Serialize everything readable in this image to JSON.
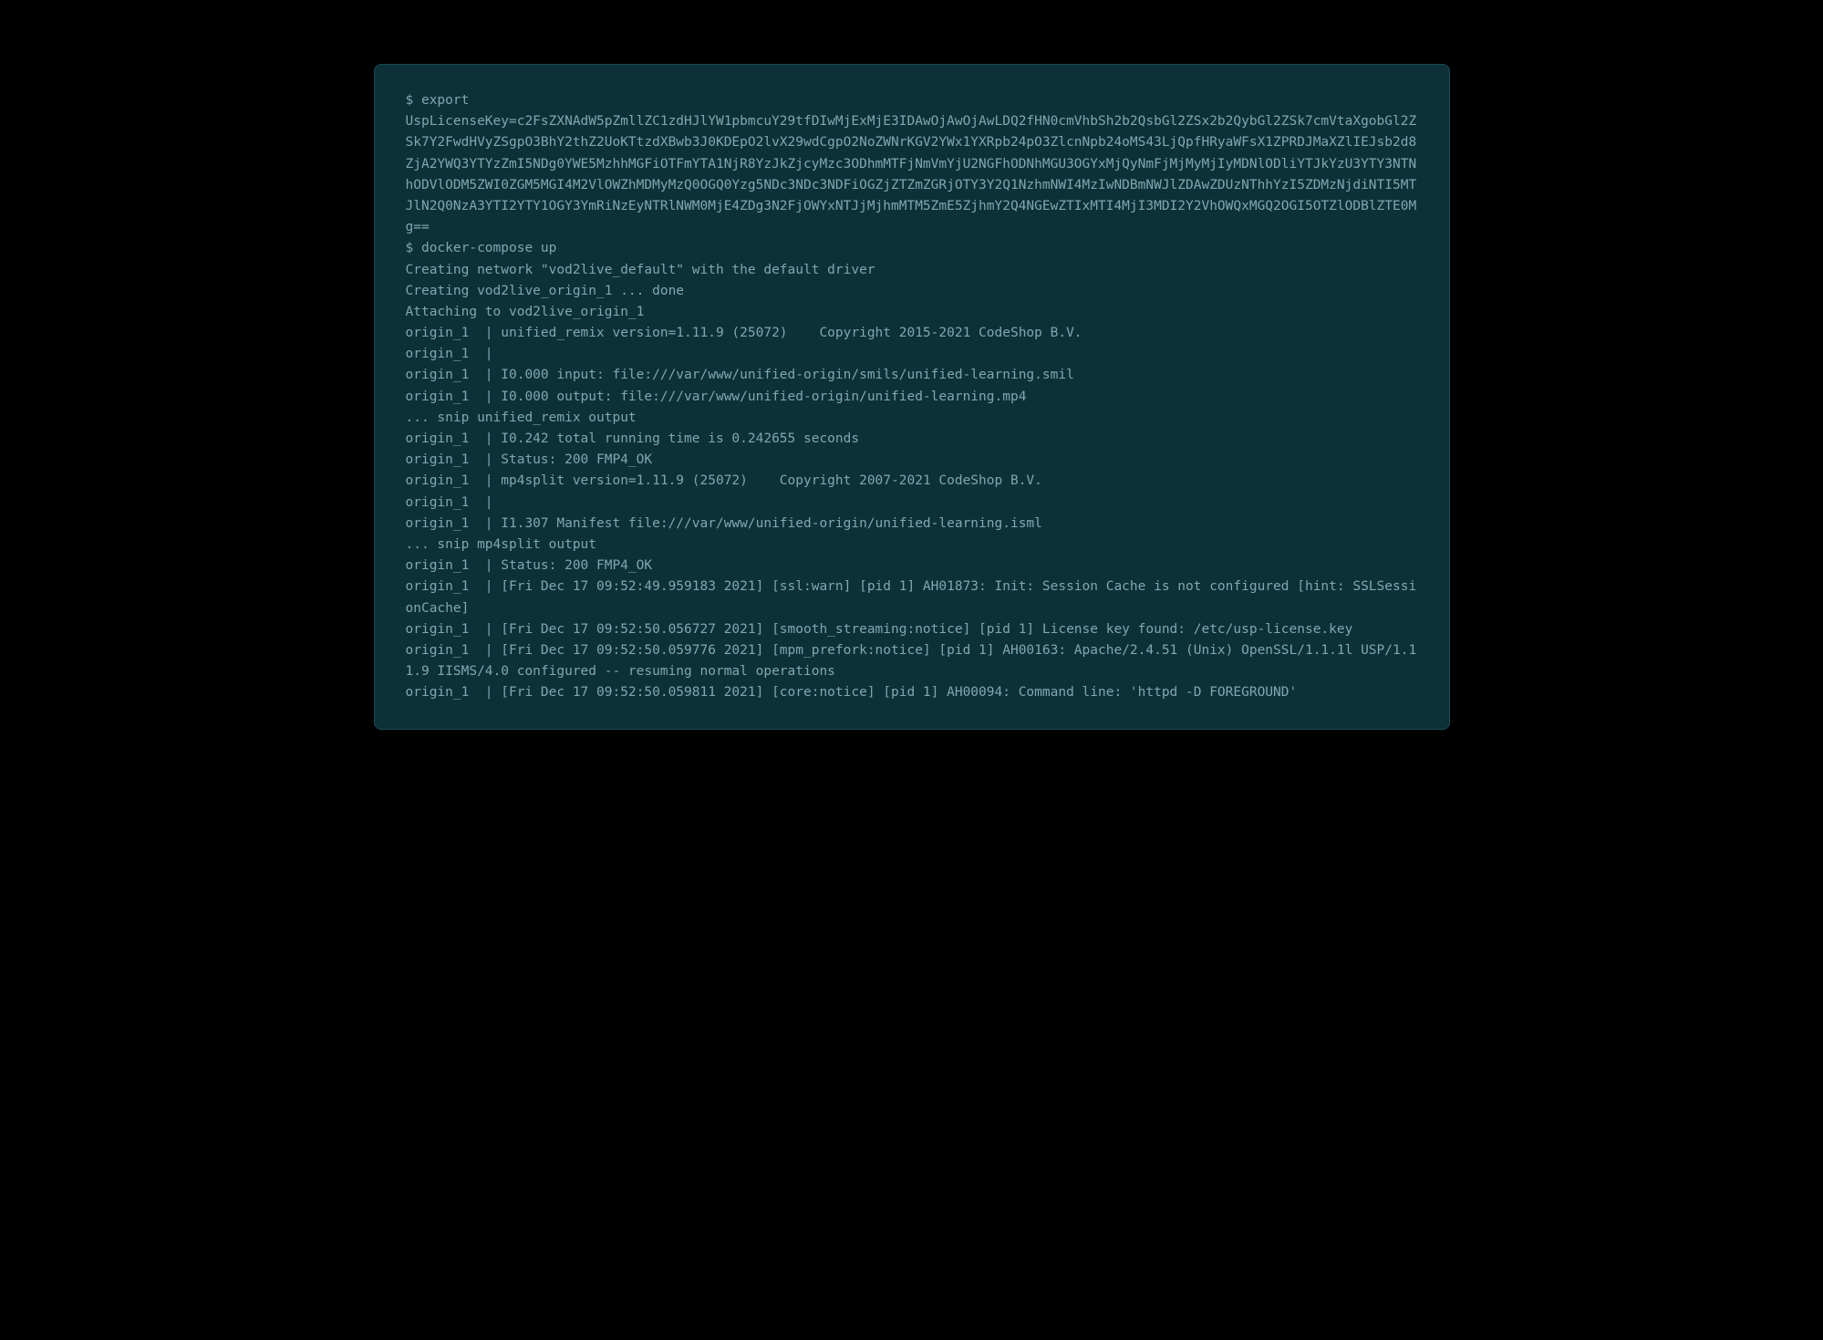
{
  "terminal": {
    "lines": [
      "$ export",
      "UspLicenseKey=c2FsZXNAdW5pZmllZC1zdHJlYW1pbmcuY29tfDIwMjExMjE3IDAwOjAwOjAwLDQ2fHN0cmVhbSh2b2QsbGl2ZSx2b2QybGl2ZSk7cmVtaXgobGl2ZSk7Y2FwdHVyZSgpO3BhY2thZ2UoKTtzdXBwb3J0KDEpO2lvX29wdCgpO2NoZWNrKGV2YWx1YXRpb24pO3ZlcnNpb24oMS43LjQpfHRyaWFsX1ZPRDJMaXZlIEJsb2d8ZjA2YWQ3YTYzZmI5NDg0YWE5MzhhMGFiOTFmYTA1NjR8YzJkZjcyMzc3ODhmMTFjNmVmYjU2NGFhODNhMGU3OGYxMjQyNmFjMjMyMjIyMDNlODliYTJkYzU3YTY3NTNhODVlODM5ZWI0ZGM5MGI4M2VlOWZhMDMyMzQ0OGQ0Yzg5NDc3NDc3NDFiOGZjZTZmZGRjOTY3Y2Q1NzhmNWI4MzIwNDBmNWJlZDAwZDUzNThhYzI5ZDMzNjdiNTI5MTJlN2Q0NzA3YTI2YTY1OGY3YmRiNzEyNTRlNWM0MjE4ZDg3N2FjOWYxNTJjMjhmMTM5ZmE5ZjhmY2Q4NGEwZTIxMTI4MjI3MDI2Y2VhOWQxMGQ2OGI5OTZlODBlZTE0Mg==",
      "$ docker-compose up",
      "Creating network \"vod2live_default\" with the default driver",
      "Creating vod2live_origin_1 ... done",
      "Attaching to vod2live_origin_1",
      "origin_1  | unified_remix version=1.11.9 (25072)    Copyright 2015-2021 CodeShop B.V.",
      "origin_1  |",
      "origin_1  | I0.000 input: file:///var/www/unified-origin/smils/unified-learning.smil",
      "origin_1  | I0.000 output: file:///var/www/unified-origin/unified-learning.mp4",
      "... snip unified_remix output",
      "origin_1  | I0.242 total running time is 0.242655 seconds",
      "origin_1  | Status: 200 FMP4_OK",
      "origin_1  | mp4split version=1.11.9 (25072)    Copyright 2007-2021 CodeShop B.V.",
      "origin_1  |",
      "origin_1  | I1.307 Manifest file:///var/www/unified-origin/unified-learning.isml",
      "... snip mp4split output",
      "origin_1  | Status: 200 FMP4_OK",
      "origin_1  | [Fri Dec 17 09:52:49.959183 2021] [ssl:warn] [pid 1] AH01873: Init: Session Cache is not configured [hint: SSLSessionCache]",
      "origin_1  | [Fri Dec 17 09:52:50.056727 2021] [smooth_streaming:notice] [pid 1] License key found: /etc/usp-license.key",
      "origin_1  | [Fri Dec 17 09:52:50.059776 2021] [mpm_prefork:notice] [pid 1] AH00163: Apache/2.4.51 (Unix) OpenSSL/1.1.1l USP/1.11.9 IISMS/4.0 configured -- resuming normal operations",
      "origin_1  | [Fri Dec 17 09:52:50.059811 2021] [core:notice] [pid 1] AH00094: Command line: 'httpd -D FOREGROUND'"
    ]
  }
}
